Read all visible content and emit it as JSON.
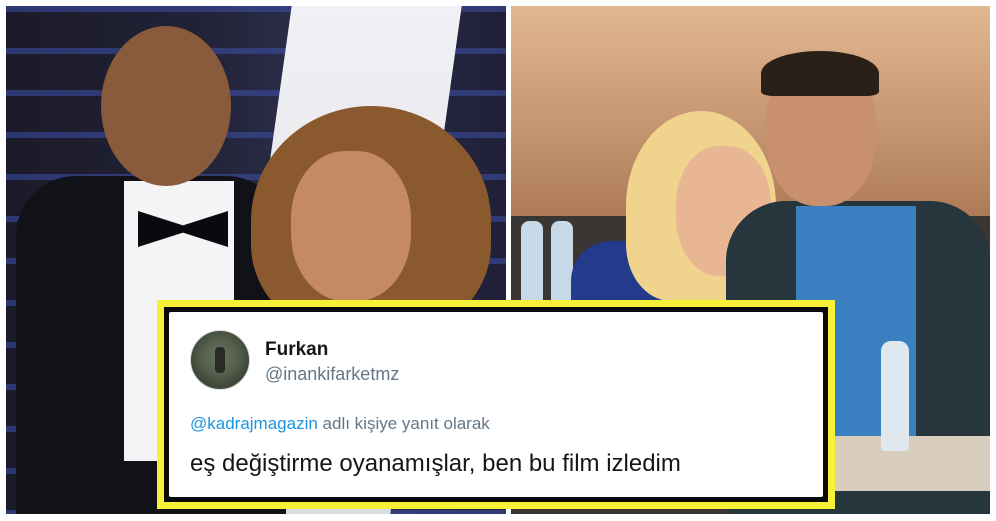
{
  "tweet": {
    "display_name": "Furkan",
    "handle": "@inankifarketmz",
    "reply_mention": "@kadrajmagazin",
    "reply_suffix": " adlı kişiye yanıt olarak",
    "text": "eş değiştirme oyanamışlar, ben bu film izledim"
  },
  "colors": {
    "frame_accent": "#f6f136",
    "mention": "#1b95e0",
    "muted_text": "#657786"
  },
  "icons": {
    "avatar": "user-avatar-photo"
  }
}
